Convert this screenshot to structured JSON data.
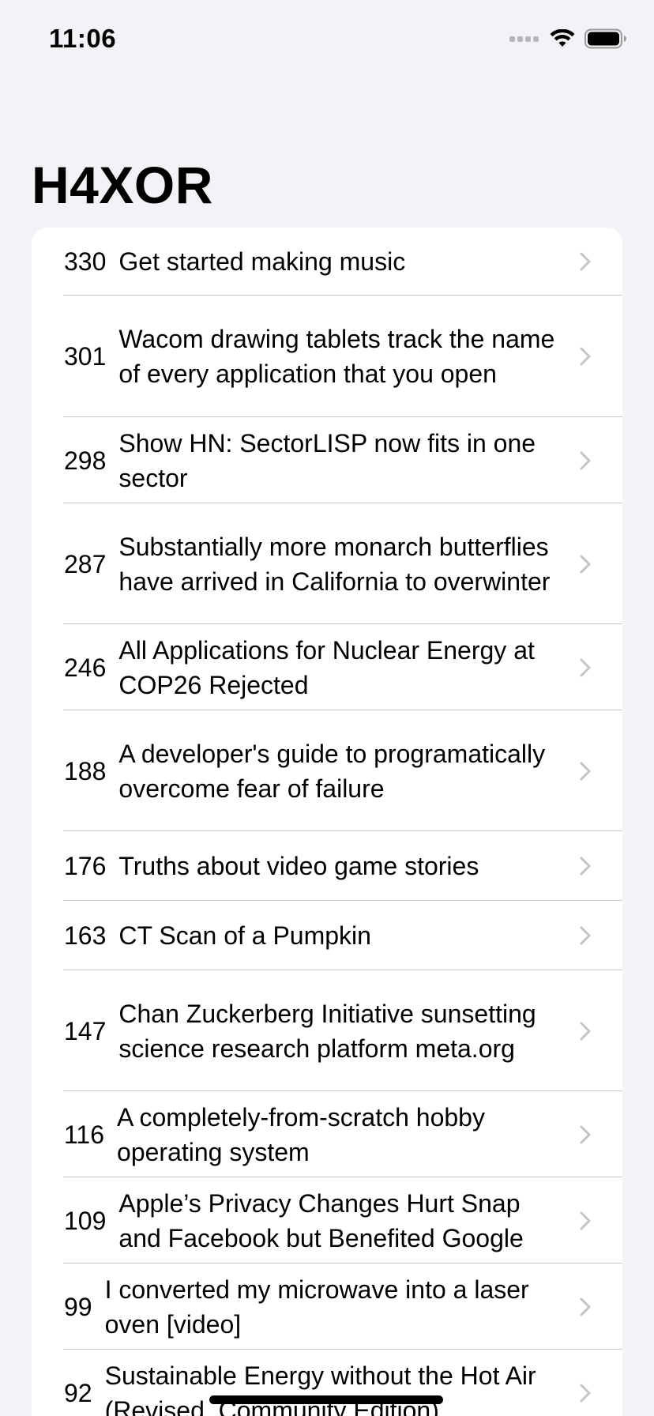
{
  "status_bar": {
    "time": "11:06"
  },
  "title": "H4XOR",
  "stories": [
    {
      "score": "330",
      "title": "Get started making music",
      "height": 86
    },
    {
      "score": "301",
      "title": "Wacom drawing tablets track the name of every application that you open",
      "height": 154
    },
    {
      "score": "298",
      "title": "Show HN: SectorLISP now fits in one sector",
      "height": 109
    },
    {
      "score": "287",
      "title": "Substantially more monarch butterflies have arrived in California to overwinter",
      "height": 153
    },
    {
      "score": "246",
      "title": "All Applications for Nuclear Energy at COP26 Rejected",
      "height": 109
    },
    {
      "score": "188",
      "title": "A developer's guide to programatically overcome fear of failure",
      "height": 153
    },
    {
      "score": "176",
      "title": "Truths about video game stories",
      "height": 88
    },
    {
      "score": "163",
      "title": "CT Scan of a Pumpkin",
      "height": 88
    },
    {
      "score": "147",
      "title": "Chan Zuckerberg Initiative sunsetting science research platform meta.org",
      "height": 153
    },
    {
      "score": "116",
      "title": "A completely-from-scratch hobby operating system",
      "height": 109
    },
    {
      "score": "109",
      "title": "Apple’s Privacy Changes Hurt Snap and Facebook but Benefited Google",
      "height": 109
    },
    {
      "score": "99",
      "title": "I converted my microwave into a laser oven [video]",
      "height": 109
    },
    {
      "score": "92",
      "title": "Sustainable Energy without the Hot Air (Revised, Community Edition)",
      "height": 109
    }
  ]
}
